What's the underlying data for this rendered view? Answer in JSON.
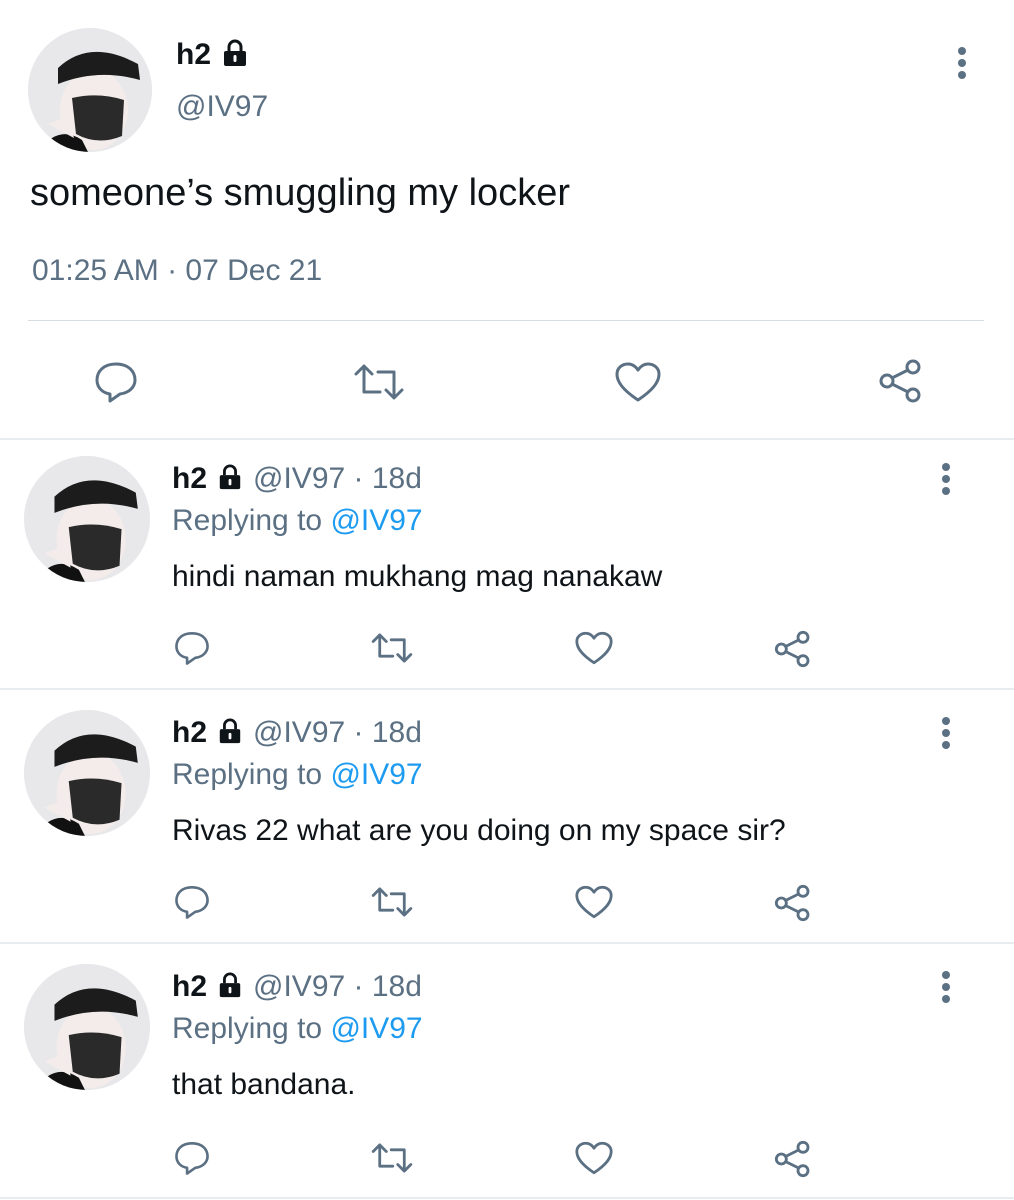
{
  "main_tweet": {
    "name": "h2",
    "handle": "@IV97",
    "text": "someone’s smuggling my locker",
    "timestamp": "01:25 AM · 07 Dec 21"
  },
  "replies": [
    {
      "name": "h2",
      "meta": "@IV97 · 18d",
      "replying_label": "Replying to",
      "replying_to": "@IV97",
      "text": "hindi naman mukhang mag nanakaw"
    },
    {
      "name": "h2",
      "meta": "@IV97 · 18d",
      "replying_label": "Replying to",
      "replying_to": "@IV97",
      "text": "Rivas 22 what are you doing on my space sir?"
    },
    {
      "name": "h2",
      "meta": "@IV97 · 18d",
      "replying_label": "Replying to",
      "replying_to": "@IV97",
      "text": "that bandana."
    }
  ],
  "icons": {
    "reply": "reply-icon",
    "retweet": "retweet-icon",
    "like": "heart-icon",
    "share": "share-icon",
    "more": "more-icon",
    "lock": "lock-icon"
  },
  "colors": {
    "link": "#1d9bf0",
    "secondary_text": "#5b7083",
    "icon_gray": "#5b7083"
  }
}
